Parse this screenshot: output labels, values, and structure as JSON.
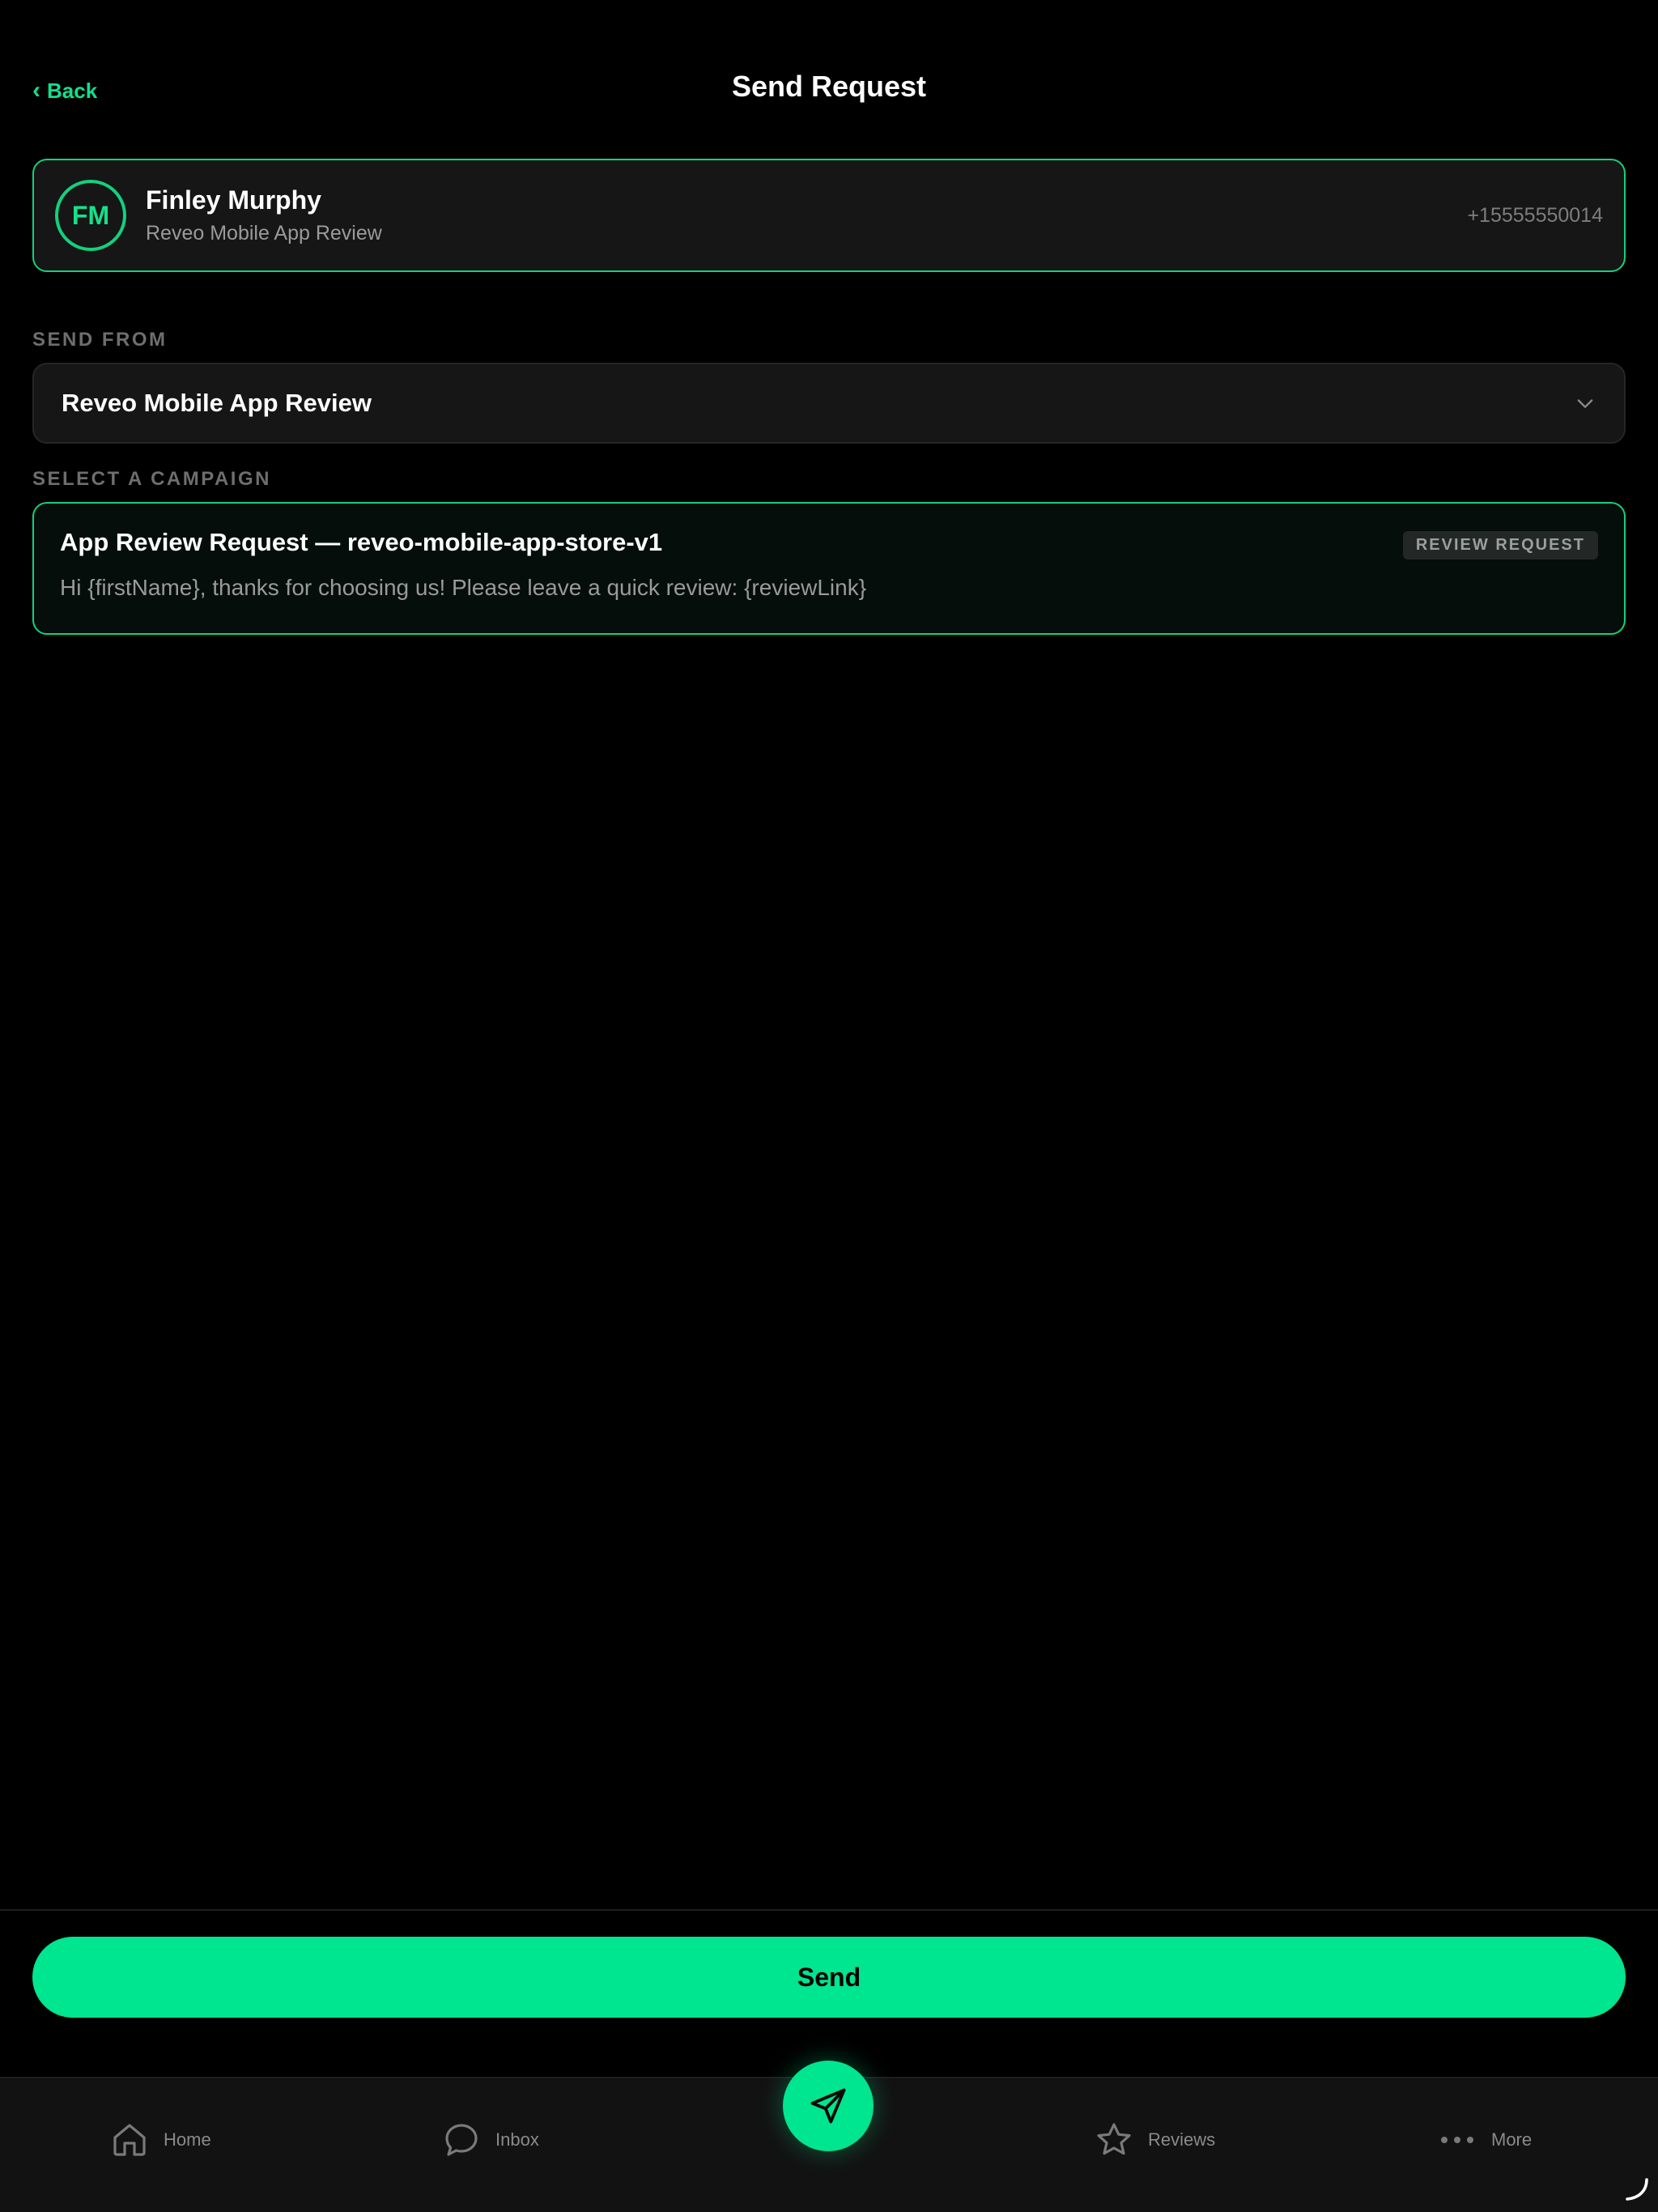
{
  "header": {
    "back_label": "Back",
    "title": "Send Request"
  },
  "recipient": {
    "initials": "FM",
    "name": "Finley Murphy",
    "subtitle": "Reveo Mobile App Review",
    "phone": "+15555550014"
  },
  "send_from": {
    "label": "SEND FROM",
    "value": "Reveo Mobile App Review"
  },
  "campaign": {
    "label": "SELECT A CAMPAIGN",
    "title": "App Review Request — reveo-mobile-app-store-v1",
    "badge": "REVIEW REQUEST",
    "message": "Hi {firstName}, thanks for choosing us! Please leave a quick review: {reviewLink}"
  },
  "actions": {
    "send_label": "Send"
  },
  "tabbar": {
    "items": [
      {
        "label": "Home",
        "icon": "home-icon"
      },
      {
        "label": "Inbox",
        "icon": "chat-bubble-icon"
      },
      {
        "label": "",
        "icon": "send-icon"
      },
      {
        "label": "Reviews",
        "icon": "star-icon"
      },
      {
        "label": "More",
        "icon": "more-dots-icon"
      }
    ]
  },
  "colors": {
    "accent": "#00e58f",
    "background": "#000000",
    "card": "#161616"
  }
}
